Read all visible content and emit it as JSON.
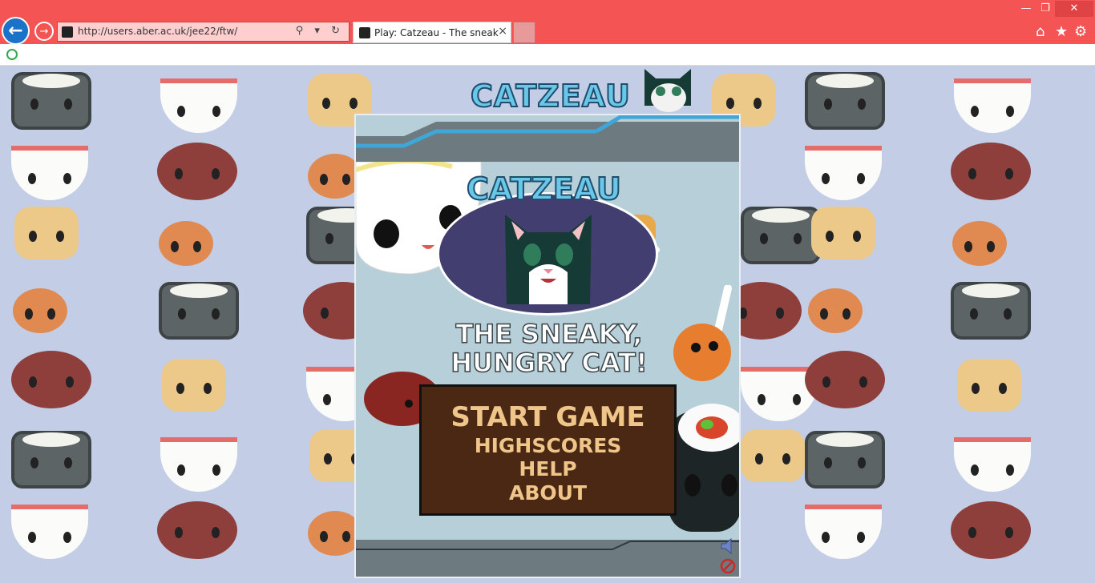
{
  "browser": {
    "url": "http://users.aber.ac.uk/jee22/ftw/",
    "tab_title": "Play: Catzeau - The sneaky, ...",
    "tab_close": "×",
    "back_glyph": "←",
    "forward_glyph": "→",
    "minimize_glyph": "—",
    "maximize_glyph": "❐",
    "close_glyph": "✕",
    "home_glyph": "⌂",
    "favorites_glyph": "★",
    "tools_glyph": "⚙",
    "address_tools": "⚲ ▾ ↻",
    "accent": "#f45454"
  },
  "game": {
    "logo_banner": "CATZEAU",
    "logo_title": "CATZEAU",
    "tagline_line1": "THE SNEAKY,",
    "tagline_line2": "HUNGRY CAT!",
    "menu": {
      "start": "START GAME",
      "highscores": "HIGHSCORES",
      "help": "HELP",
      "about": "ABOUT"
    },
    "icons": [
      "sound-icon",
      "mute-icon"
    ]
  }
}
